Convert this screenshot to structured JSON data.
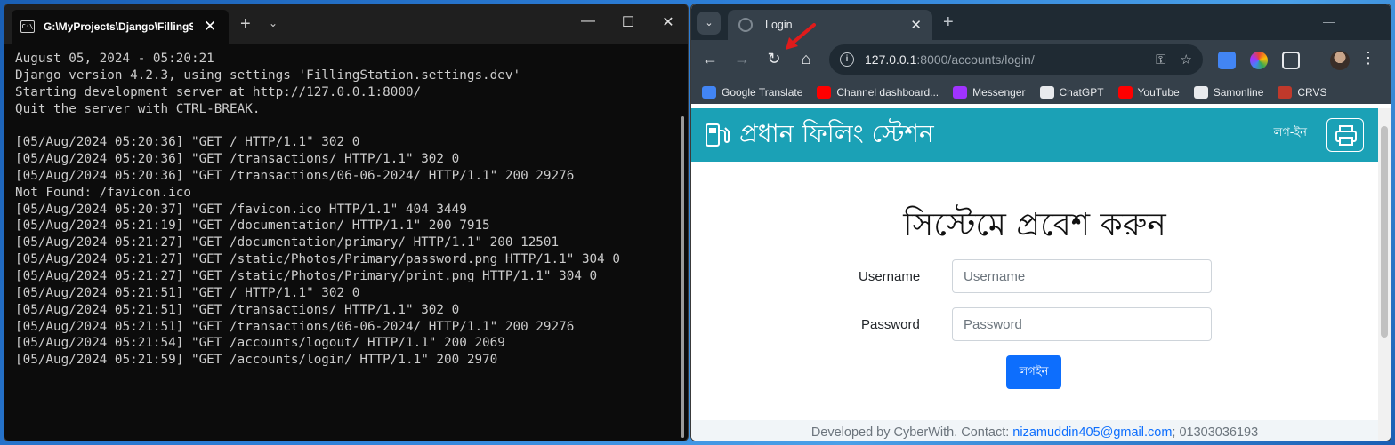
{
  "terminal": {
    "tab_title": "G:\\MyProjects\\Django\\FillingS",
    "lines": [
      "August 05, 2024 - 05:20:21",
      "Django version 4.2.3, using settings 'FillingStation.settings.dev'",
      "Starting development server at http://127.0.0.1:8000/",
      "Quit the server with CTRL-BREAK.",
      "",
      "[05/Aug/2024 05:20:36] \"GET / HTTP/1.1\" 302 0",
      "[05/Aug/2024 05:20:36] \"GET /transactions/ HTTP/1.1\" 302 0",
      "[05/Aug/2024 05:20:36] \"GET /transactions/06-06-2024/ HTTP/1.1\" 200 29276",
      "Not Found: /favicon.ico",
      "[05/Aug/2024 05:20:37] \"GET /favicon.ico HTTP/1.1\" 404 3449",
      "[05/Aug/2024 05:21:19] \"GET /documentation/ HTTP/1.1\" 200 7915",
      "[05/Aug/2024 05:21:27] \"GET /documentation/primary/ HTTP/1.1\" 200 12501",
      "[05/Aug/2024 05:21:27] \"GET /static/Photos/Primary/password.png HTTP/1.1\" 304 0",
      "[05/Aug/2024 05:21:27] \"GET /static/Photos/Primary/print.png HTTP/1.1\" 304 0",
      "[05/Aug/2024 05:21:51] \"GET / HTTP/1.1\" 302 0",
      "[05/Aug/2024 05:21:51] \"GET /transactions/ HTTP/1.1\" 302 0",
      "[05/Aug/2024 05:21:51] \"GET /transactions/06-06-2024/ HTTP/1.1\" 200 29276",
      "[05/Aug/2024 05:21:54] \"GET /accounts/logout/ HTTP/1.1\" 200 2069",
      "[05/Aug/2024 05:21:59] \"GET /accounts/login/ HTTP/1.1\" 200 2970"
    ]
  },
  "browser": {
    "tab_title": "Login",
    "url_host": "127.0.0.1",
    "url_rest": ":8000/accounts/login/",
    "bookmarks": [
      {
        "label": "Google Translate",
        "color": "#4285f4"
      },
      {
        "label": "Channel dashboard...",
        "color": "#ff0000"
      },
      {
        "label": "Messenger",
        "color": "#a033ff"
      },
      {
        "label": "ChatGPT",
        "color": "#e8eaed"
      },
      {
        "label": "YouTube",
        "color": "#ff0000"
      },
      {
        "label": "Samonline",
        "color": "#e8eaed"
      },
      {
        "label": "CRVS",
        "color": "#c0392b"
      }
    ]
  },
  "site": {
    "title": "প্রধান ফিলিং স্টেশন",
    "login_link": "লগ-ইন",
    "heading": "সিস্টেমে প্রবেশ করুন",
    "username_label": "Username",
    "username_placeholder": "Username",
    "password_label": "Password",
    "password_placeholder": "Password",
    "login_button": "লগইন",
    "footer_text": "Developed by CyberWith. Contact: ",
    "footer_email": "nizamuddin405@gmail.com",
    "footer_phone": "; 01303036193",
    "header_color": "#1ba1b6",
    "button_color": "#0d6efd"
  }
}
